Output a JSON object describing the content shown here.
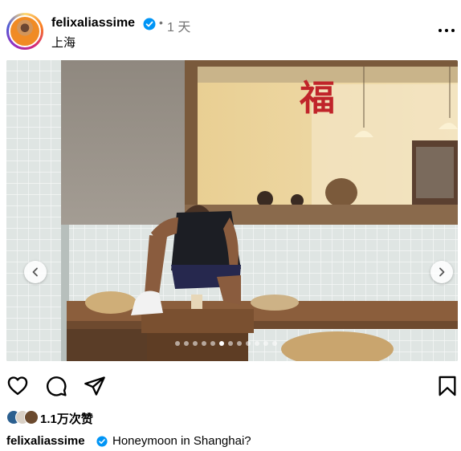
{
  "post": {
    "username": "felixaliassime",
    "separator": "•",
    "time": "1 天",
    "location": "上海",
    "likes": "1.1万次赞",
    "caption_user": "felixaliassime",
    "caption": "Honeymoon in Shanghai?",
    "photo_sign_text": "福"
  },
  "carousel": {
    "count": 12,
    "active_index": 5
  },
  "colors": {
    "verified": "#0095f6",
    "text_secondary": "#737373"
  },
  "icons": {
    "more": "more-options-icon",
    "like": "heart-icon",
    "comment": "comment-icon",
    "share": "paper-plane-icon",
    "save": "bookmark-icon",
    "prev": "chevron-left-icon",
    "next": "chevron-right-icon"
  }
}
